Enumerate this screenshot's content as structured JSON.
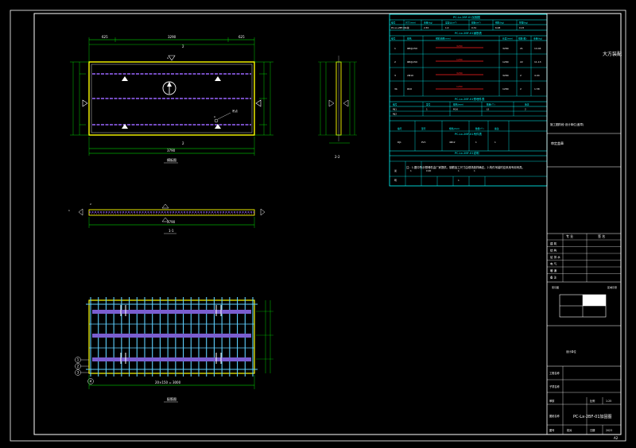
{
  "drawing": {
    "sheet_size_label": "A2"
  },
  "top_view": {
    "caption": "模板图",
    "dims_top": [
      "625",
      "3290",
      "625"
    ],
    "dim_bottom": "3790",
    "section_mark": "2",
    "note": "吊点"
  },
  "side_view": {
    "caption": "2-2"
  },
  "section_view": {
    "caption": "1-1",
    "dim_bottom": "3790"
  },
  "rebar_view": {
    "caption": "配筋图",
    "dim_bottom": "20×150 = 3000",
    "markers": [
      "1",
      "2",
      "3",
      "4"
    ]
  },
  "schedule": {
    "title1": "PC-Lx-2BF-01加固图",
    "header1": [
      "编号",
      "尺寸(mm)",
      "重量(kg)",
      "混凝土(m³)",
      "模板(m²)",
      "钢筋(kg)",
      "预埋(kg)"
    ],
    "row1": [
      "PC-Lx-2BF-01",
      "1块",
      "2.55",
      "1.0",
      "0.31",
      "6.08",
      "0.15"
    ],
    "title2": "PC-Lx-2BF-01钢筋表",
    "header2": [
      "编号",
      "规格",
      "钢筋简图(mm)",
      "长度(mm)",
      "根数(根)",
      "重量(kg)"
    ],
    "rows2": [
      {
        "id": "1",
        "spec": "Φ8@150",
        "shape": "3280",
        "len": "3280",
        "n": "21",
        "w": "14.04"
      },
      {
        "id": "2",
        "spec": "Φ8@150",
        "shape": "1280",
        "len": "1280",
        "n": "22",
        "w": "11.13"
      },
      {
        "id": "3",
        "spec": "2Φ10",
        "shape": "3280",
        "len": "3280",
        "n": "2",
        "w": "4.04"
      },
      {
        "id": "3b",
        "spec": "Φ10",
        "shape": "1280",
        "len": "1280",
        "n": "2",
        "w": "1.58"
      }
    ],
    "title3": "PC-Lx-2BF-01预埋件表",
    "header3": [
      "编号",
      "型号",
      "规格(mm)",
      "数量(个)",
      "备注"
    ],
    "rows3": [
      [
        "MJ1",
        "1",
        "M16",
        "L5",
        "2"
      ],
      [
        "MJ2",
        "",
        "",
        "",
        ""
      ]
    ],
    "title4": "PC-Lx-2BF-01吊件表",
    "header4": [
      "编号",
      "型号",
      "规格(mm)",
      "数量(个)",
      "备注"
    ],
    "rows4": [
      [
        "DJ1",
        "PVC",
        "4Φ12",
        "1",
        "1"
      ]
    ],
    "title5": "PC-Lx-2BF-01说明",
    "note5": "注：1.图中所示预埋件由厂家提供，钢筋加工尺寸由现场放样确定。2.构件吊装时应采用专用吊具。",
    "rows5": [
      [
        "说",
        "1",
        "0.90",
        "1",
        "1"
      ],
      [
        "明",
        "",
        "",
        "1",
        ""
      ]
    ]
  },
  "title_block": {
    "project_cn": "大方装配",
    "company_note": "施工图阶段·设计单位(盖章)",
    "stage": "审定盖章",
    "sign_header": [
      "专 业",
      "签 名"
    ],
    "sign_rows": [
      "建 筑",
      "结 构",
      "给 排 水",
      "电 气",
      "暖 通",
      "备 注"
    ],
    "key_plan_label": "索引图",
    "key_plan_note": "区域示意",
    "company_label": "设计单位",
    "project_label": "工程名称",
    "subproject_label": "子项名称",
    "review_label": "审核",
    "design_label": "设计",
    "check_label": "校对",
    "ratio_label": "比例",
    "ratio_value": "1:25",
    "drawing_title_label": "图纸名称",
    "drawing_title": "PC-Lx-2BF-01加固图",
    "drawing_no_label": "图号",
    "date_label": "日期",
    "date_value": "2023"
  }
}
